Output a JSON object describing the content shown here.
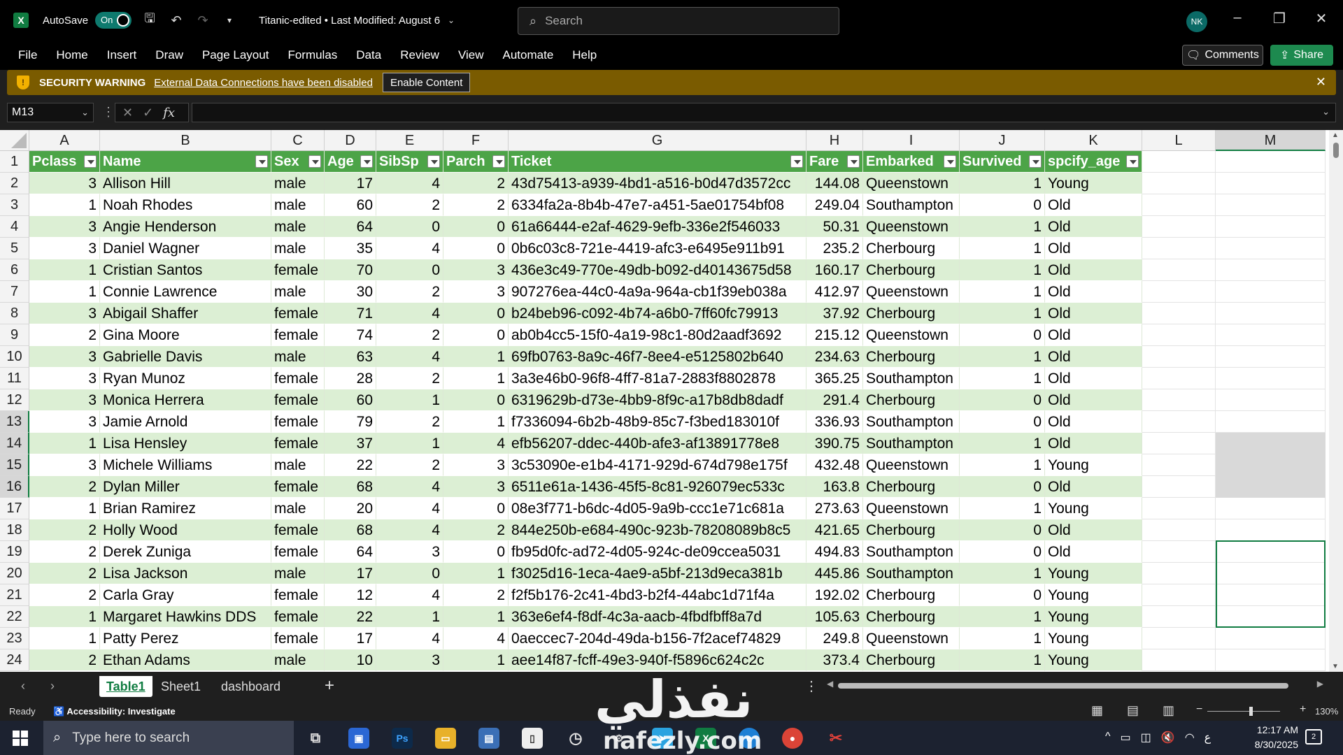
{
  "titlebar": {
    "app_icon": "excel-icon",
    "autosave_label": "AutoSave",
    "autosave_state": "On",
    "doc_title": "Titanic-edited • Last Modified: August 6",
    "search_placeholder": "Search",
    "avatar_initials": "NK"
  },
  "menu": [
    "File",
    "Home",
    "Insert",
    "Draw",
    "Page Layout",
    "Formulas",
    "Data",
    "Review",
    "View",
    "Automate",
    "Help"
  ],
  "actions": {
    "comments": "Comments",
    "share": "Share"
  },
  "security": {
    "title": "SECURITY WARNING",
    "message": "External Data Connections have been disabled",
    "button": "Enable Content"
  },
  "formula_bar": {
    "name_box": "M13",
    "fx": "fx",
    "value": ""
  },
  "columns": [
    "A",
    "B",
    "C",
    "D",
    "E",
    "F",
    "G",
    "H",
    "I",
    "J",
    "K",
    "L",
    "M"
  ],
  "selected_column": "M",
  "selected_rows": [
    13,
    14,
    15,
    16
  ],
  "table": {
    "headers": [
      "Pclass",
      "Name",
      "Sex",
      "Age",
      "SibSp",
      "Parch",
      "Ticket",
      "Fare",
      "Embarked",
      "Survived",
      "spcify_age"
    ],
    "rows": [
      [
        "3",
        "Allison Hill",
        "male",
        "17",
        "4",
        "2",
        "43d75413-a939-4bd1-a516-b0d47d3572cc",
        "144.08",
        "Queenstown",
        "1",
        "Young"
      ],
      [
        "1",
        "Noah Rhodes",
        "male",
        "60",
        "2",
        "2",
        "6334fa2a-8b4b-47e7-a451-5ae01754bf08",
        "249.04",
        "Southampton",
        "0",
        "Old"
      ],
      [
        "3",
        "Angie Henderson",
        "male",
        "64",
        "0",
        "0",
        "61a66444-e2af-4629-9efb-336e2f546033",
        "50.31",
        "Queenstown",
        "1",
        "Old"
      ],
      [
        "3",
        "Daniel Wagner",
        "male",
        "35",
        "4",
        "0",
        "0b6c03c8-721e-4419-afc3-e6495e911b91",
        "235.2",
        "Cherbourg",
        "1",
        "Old"
      ],
      [
        "1",
        "Cristian Santos",
        "female",
        "70",
        "0",
        "3",
        "436e3c49-770e-49db-b092-d40143675d58",
        "160.17",
        "Cherbourg",
        "1",
        "Old"
      ],
      [
        "1",
        "Connie Lawrence",
        "male",
        "30",
        "2",
        "3",
        "907276ea-44c0-4a9a-964a-cb1f39eb038a",
        "412.97",
        "Queenstown",
        "1",
        "Old"
      ],
      [
        "3",
        "Abigail Shaffer",
        "female",
        "71",
        "4",
        "0",
        "b24beb96-c092-4b74-a6b0-7ff60fc79913",
        "37.92",
        "Cherbourg",
        "1",
        "Old"
      ],
      [
        "2",
        "Gina Moore",
        "female",
        "74",
        "2",
        "0",
        "ab0b4cc5-15f0-4a19-98c1-80d2aadf3692",
        "215.12",
        "Queenstown",
        "0",
        "Old"
      ],
      [
        "3",
        "Gabrielle Davis",
        "male",
        "63",
        "4",
        "1",
        "69fb0763-8a9c-46f7-8ee4-e5125802b640",
        "234.63",
        "Cherbourg",
        "1",
        "Old"
      ],
      [
        "3",
        "Ryan Munoz",
        "female",
        "28",
        "2",
        "1",
        "3a3e46b0-96f8-4ff7-81a7-2883f8802878",
        "365.25",
        "Southampton",
        "1",
        "Old"
      ],
      [
        "3",
        "Monica Herrera",
        "female",
        "60",
        "1",
        "0",
        "6319629b-d73e-4bb9-8f9c-a17b8db8dadf",
        "291.4",
        "Cherbourg",
        "0",
        "Old"
      ],
      [
        "3",
        "Jamie Arnold",
        "female",
        "79",
        "2",
        "1",
        "f7336094-6b2b-48b9-85c7-f3bed183010f",
        "336.93",
        "Southampton",
        "0",
        "Old"
      ],
      [
        "1",
        "Lisa Hensley",
        "female",
        "37",
        "1",
        "4",
        "efb56207-ddec-440b-afe3-af13891778e8",
        "390.75",
        "Southampton",
        "1",
        "Old"
      ],
      [
        "3",
        "Michele Williams",
        "male",
        "22",
        "2",
        "3",
        "3c53090e-e1b4-4171-929d-674d798e175f",
        "432.48",
        "Queenstown",
        "1",
        "Young"
      ],
      [
        "2",
        "Dylan Miller",
        "female",
        "68",
        "4",
        "3",
        "6511e61a-1436-45f5-8c81-926079ec533c",
        "163.8",
        "Cherbourg",
        "0",
        "Old"
      ],
      [
        "1",
        "Brian Ramirez",
        "male",
        "20",
        "4",
        "0",
        "08e3f771-b6dc-4d05-9a9b-ccc1e71c681a",
        "273.63",
        "Queenstown",
        "1",
        "Young"
      ],
      [
        "2",
        "Holly Wood",
        "female",
        "68",
        "4",
        "2",
        "844e250b-e684-490c-923b-78208089b8c5",
        "421.65",
        "Cherbourg",
        "0",
        "Old"
      ],
      [
        "2",
        "Derek Zuniga",
        "female",
        "64",
        "3",
        "0",
        "fb95d0fc-ad72-4d05-924c-de09ccea5031",
        "494.83",
        "Southampton",
        "0",
        "Old"
      ],
      [
        "2",
        "Lisa Jackson",
        "male",
        "17",
        "0",
        "1",
        "f3025d16-1eca-4ae9-a5bf-213d9eca381b",
        "445.86",
        "Southampton",
        "1",
        "Young"
      ],
      [
        "2",
        "Carla Gray",
        "female",
        "12",
        "4",
        "2",
        "f2f5b176-2c41-4bd3-b2f4-44abc1d71f4a",
        "192.02",
        "Cherbourg",
        "0",
        "Young"
      ],
      [
        "1",
        "Margaret Hawkins DDS",
        "female",
        "22",
        "1",
        "1",
        "363e6ef4-f8df-4c3a-aacb-4fbdfbff8a7d",
        "105.63",
        "Cherbourg",
        "1",
        "Young"
      ],
      [
        "1",
        "Patty Perez",
        "female",
        "17",
        "4",
        "4",
        "0aeccec7-204d-49da-b156-7f2acef74829",
        "249.8",
        "Queenstown",
        "1",
        "Young"
      ],
      [
        "2",
        "Ethan Adams",
        "male",
        "10",
        "3",
        "1",
        "aee14f87-fcff-49e3-940f-f5896c624c2c",
        "373.4",
        "Cherbourg",
        "1",
        "Young"
      ]
    ]
  },
  "sheets": [
    "Table1",
    "Sheet1",
    "dashboard"
  ],
  "active_sheet": "Table1",
  "status": {
    "ready": "Ready",
    "accessibility": "Accessibility: Investigate",
    "zoom": "130%"
  },
  "taskbar": {
    "search_placeholder": "Type here to search",
    "time": "12:17 AM",
    "date": "8/30/2025",
    "notifications": "2",
    "tray_lang": "ع"
  },
  "watermark": {
    "arabic": "نفذلي",
    "latin": "nafezly.com"
  },
  "colors": {
    "header_green": "#4ca447",
    "band_green": "#dcefd4",
    "accent": "#107c41",
    "warning_bar": "#7a5b00"
  }
}
